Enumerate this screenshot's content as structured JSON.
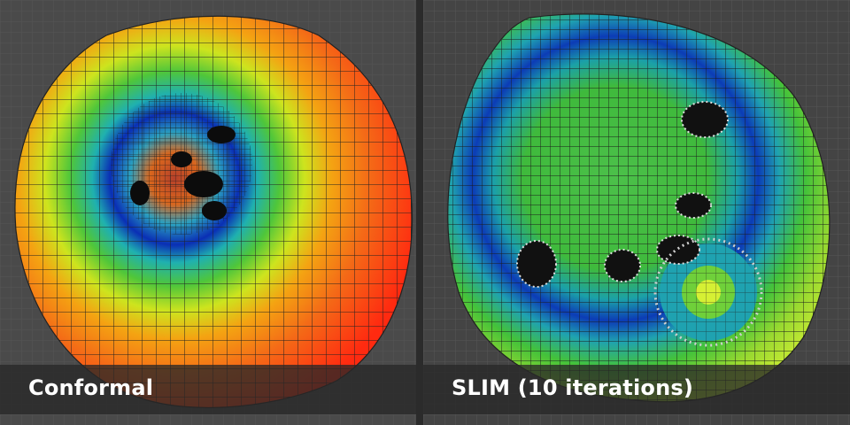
{
  "panels": [
    {
      "caption": "Conformal",
      "colors": {
        "outer": "#ff3b17",
        "mid": "#f4a312",
        "inner": "#0a2fb5",
        "center": "#c04a20"
      }
    },
    {
      "caption": "SLIM (10 iterations)",
      "colors": {
        "outer": "#d6f034",
        "mid": "#3fcc3a",
        "inner": "#0c3cb6",
        "center": "#4cc04a"
      }
    }
  ]
}
